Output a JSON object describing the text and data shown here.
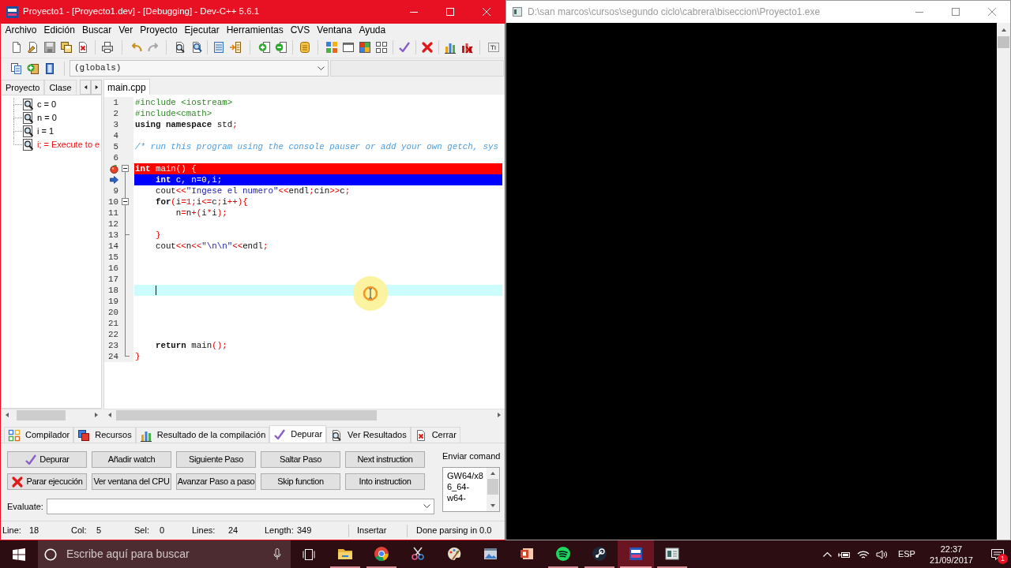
{
  "ide": {
    "title": "Proyecto1 - [Proyecto1.dev] - [Debugging] - Dev-C++ 5.6.1",
    "menu": [
      "Archivo",
      "Edición",
      "Buscar",
      "Ver",
      "Proyecto",
      "Ejecutar",
      "Herramientas",
      "CVS",
      "Ventana",
      "Ayuda"
    ],
    "scope_combo": {
      "value": "(globals)"
    },
    "left_tabs": [
      {
        "label": "Proyecto",
        "selected": false
      },
      {
        "label": "Clase",
        "selected": false
      }
    ],
    "watches": [
      {
        "text": "c = 0",
        "error": false
      },
      {
        "text": "n = 0",
        "error": false
      },
      {
        "text": "i = 1",
        "error": false
      },
      {
        "text": "i; = Execute to e",
        "error": true
      }
    ],
    "editor_tabs": [
      {
        "label": "main.cpp",
        "selected": true
      }
    ],
    "code": [
      {
        "number": "1",
        "kind": "plain",
        "fold_start": false,
        "fold_end": false,
        "caret": false,
        "tokens": [
          {
            "text": "#include <iostream>",
            "kind": "pre"
          }
        ]
      },
      {
        "number": "2",
        "kind": "plain",
        "fold_start": false,
        "fold_end": false,
        "caret": false,
        "tokens": [
          {
            "text": "#include<cmath>",
            "kind": "pre"
          }
        ]
      },
      {
        "number": "3",
        "kind": "plain",
        "fold_start": false,
        "fold_end": false,
        "caret": false,
        "tokens": [
          {
            "text": "using namespace",
            "kind": "kw"
          },
          {
            "text": " std",
            "kind": "txt"
          },
          {
            "text": ";",
            "kind": "sym"
          }
        ]
      },
      {
        "number": "4",
        "kind": "plain",
        "fold_start": false,
        "fold_end": false,
        "caret": false
      },
      {
        "number": "5",
        "kind": "plain",
        "fold_start": false,
        "fold_end": false,
        "caret": false,
        "tokens": [
          {
            "text": "/* run this program using the console pauser or add your own getch, sys",
            "kind": "cmt"
          }
        ]
      },
      {
        "number": "6",
        "kind": "plain",
        "fold_start": false,
        "fold_end": false,
        "caret": false
      },
      {
        "kind": "breakpoint",
        "fold_start": true,
        "fold_end": false,
        "caret": false,
        "tokens": [
          {
            "text": "int",
            "kind": "kw"
          },
          {
            "text": " main",
            "kind": "txt"
          },
          {
            "text": "() {",
            "kind": "sym"
          }
        ]
      },
      {
        "kind": "execution",
        "fold_start": false,
        "fold_end": false,
        "caret": false,
        "tokens": [
          {
            "text": "    int",
            "kind": "kw"
          },
          {
            "text": " c, n=0,i;",
            "kind": "txt"
          }
        ]
      },
      {
        "number": "9",
        "kind": "plain",
        "fold_start": false,
        "fold_end": false,
        "caret": false,
        "tokens": [
          {
            "text": "    cout",
            "kind": "txt"
          },
          {
            "text": "<<",
            "kind": "sym"
          },
          {
            "text": "\"Ingese el numero\"",
            "kind": "str"
          },
          {
            "text": "<<",
            "kind": "sym"
          },
          {
            "text": "endl",
            "kind": "txt"
          },
          {
            "text": ";",
            "kind": "sym"
          },
          {
            "text": "cin",
            "kind": "txt"
          },
          {
            "text": ">>",
            "kind": "sym"
          },
          {
            "text": "c",
            "kind": "txt"
          },
          {
            "text": ";",
            "kind": "sym"
          }
        ]
      },
      {
        "number": "10",
        "kind": "plain",
        "fold_start": true,
        "fold_end": false,
        "caret": false,
        "tokens": [
          {
            "text": "    for",
            "kind": "kw"
          },
          {
            "text": "(",
            "kind": "sym"
          },
          {
            "text": "i",
            "kind": "txt"
          },
          {
            "text": "=1;",
            "kind": "sym"
          },
          {
            "text": "i",
            "kind": "txt"
          },
          {
            "text": "<=",
            "kind": "sym"
          },
          {
            "text": "c",
            "kind": "txt"
          },
          {
            "text": ";",
            "kind": "sym"
          },
          {
            "text": "i",
            "kind": "txt"
          },
          {
            "text": "++){",
            "kind": "sym"
          }
        ]
      },
      {
        "number": "11",
        "kind": "plain",
        "fold_start": false,
        "fold_end": false,
        "caret": false,
        "tokens": [
          {
            "text": "        n",
            "kind": "txt"
          },
          {
            "text": "=",
            "kind": "sym"
          },
          {
            "text": "n",
            "kind": "txt"
          },
          {
            "text": "+(",
            "kind": "sym"
          },
          {
            "text": "i",
            "kind": "txt"
          },
          {
            "text": "*",
            "kind": "sym"
          },
          {
            "text": "i",
            "kind": "txt"
          },
          {
            "text": ");",
            "kind": "sym"
          }
        ]
      },
      {
        "number": "12",
        "kind": "plain",
        "fold_start": false,
        "fold_end": false,
        "caret": false
      },
      {
        "number": "13",
        "kind": "plain",
        "fold_start": false,
        "fold_end": true,
        "caret": false,
        "tokens": [
          {
            "text": "    }",
            "kind": "sym"
          }
        ]
      },
      {
        "number": "14",
        "kind": "plain",
        "fold_start": false,
        "fold_end": false,
        "caret": false,
        "tokens": [
          {
            "text": "    cout",
            "kind": "txt"
          },
          {
            "text": "<<",
            "kind": "sym"
          },
          {
            "text": "n",
            "kind": "txt"
          },
          {
            "text": "<<",
            "kind": "sym"
          },
          {
            "text": "\"\\n\\n\"",
            "kind": "str"
          },
          {
            "text": "<<",
            "kind": "sym"
          },
          {
            "text": "endl",
            "kind": "txt"
          },
          {
            "text": ";",
            "kind": "sym"
          }
        ]
      },
      {
        "number": "15",
        "kind": "plain",
        "fold_start": false,
        "fold_end": false,
        "caret": false
      },
      {
        "number": "16",
        "kind": "plain",
        "fold_start": false,
        "fold_end": false,
        "caret": false
      },
      {
        "number": "17",
        "kind": "plain",
        "fold_start": false,
        "fold_end": false,
        "caret": false
      },
      {
        "number": "18",
        "kind": "current",
        "fold_start": false,
        "fold_end": false,
        "caret": true
      },
      {
        "number": "19",
        "kind": "plain",
        "fold_start": false,
        "fold_end": false,
        "caret": false
      },
      {
        "number": "20",
        "kind": "plain",
        "fold_start": false,
        "fold_end": false,
        "caret": false
      },
      {
        "number": "21",
        "kind": "plain",
        "fold_start": false,
        "fold_end": false,
        "caret": false
      },
      {
        "number": "22",
        "kind": "plain",
        "fold_start": false,
        "fold_end": false,
        "caret": false
      },
      {
        "number": "23",
        "kind": "plain",
        "fold_start": false,
        "fold_end": false,
        "caret": false,
        "tokens": [
          {
            "text": "    return",
            "kind": "kw"
          },
          {
            "text": " main",
            "kind": "txt"
          },
          {
            "text": "();",
            "kind": "sym"
          }
        ]
      },
      {
        "number": "24",
        "kind": "plain",
        "fold_start": false,
        "fold_end": true,
        "caret": false,
        "tokens": [
          {
            "text": "}",
            "kind": "sym"
          }
        ]
      }
    ],
    "bottom_tabs": [
      {
        "label": "Compilador",
        "selected": false
      },
      {
        "label": "Recursos",
        "selected": false
      },
      {
        "label": "Resultado de la compilación",
        "selected": false
      },
      {
        "label": "Depurar",
        "selected": true
      },
      {
        "label": "Ver Resultados",
        "selected": false
      },
      {
        "label": "Cerrar",
        "selected": false
      }
    ],
    "debug_buttons": [
      {
        "label": "Depurar",
        "kind": "start"
      },
      {
        "label": "Añadir watch",
        "kind": "plain"
      },
      {
        "label": "Siguiente Paso",
        "kind": "plain"
      },
      {
        "label": "Saltar Paso",
        "kind": "plain"
      },
      {
        "label": "Next instruction",
        "kind": "plain"
      },
      {
        "label": "Parar ejecución",
        "kind": "stop"
      },
      {
        "label": "Ver ventana del CPU",
        "kind": "plain"
      },
      {
        "label": "Avanzar Paso a paso",
        "kind": "plain"
      },
      {
        "label": "Skip function",
        "kind": "plain"
      },
      {
        "label": "Into instruction",
        "kind": "plain"
      }
    ],
    "send_command": {
      "label": "Enviar comand",
      "lines": [
        "GW64/x8",
        "6_64-",
        "w64-"
      ]
    },
    "evaluate": {
      "label": "Evaluate:"
    },
    "status_bar": {
      "fields": [
        {
          "label": "Line:",
          "value": "18"
        },
        {
          "label": "Col:",
          "value": "5"
        },
        {
          "label": "Sel:",
          "value": "0"
        },
        {
          "label": "Lines:",
          "value": "24"
        },
        {
          "label": "Length:",
          "value": "349"
        }
      ],
      "mode": "Insertar",
      "message": "Done parsing in 0.0"
    }
  },
  "console": {
    "title": "D:\\san marcos\\cursos\\segundo ciclo\\cabrera\\biseccion\\Proyecto1.exe"
  },
  "taskbar": {
    "search": {
      "placeholder": "Escribe aquí para buscar"
    },
    "apps": [
      {
        "running": true,
        "selected": false
      },
      {
        "running": true,
        "selected": false
      },
      {
        "running": false,
        "selected": false
      },
      {
        "running": false,
        "selected": false
      },
      {
        "running": false,
        "selected": false
      },
      {
        "running": false,
        "selected": false
      },
      {
        "running": true,
        "selected": false
      },
      {
        "running": true,
        "selected": false
      },
      {
        "running": true,
        "selected": true
      },
      {
        "running": true,
        "selected": false
      }
    ],
    "language": "ESP",
    "time": "22:37",
    "date": "21/09/2017",
    "notifications": "1"
  }
}
